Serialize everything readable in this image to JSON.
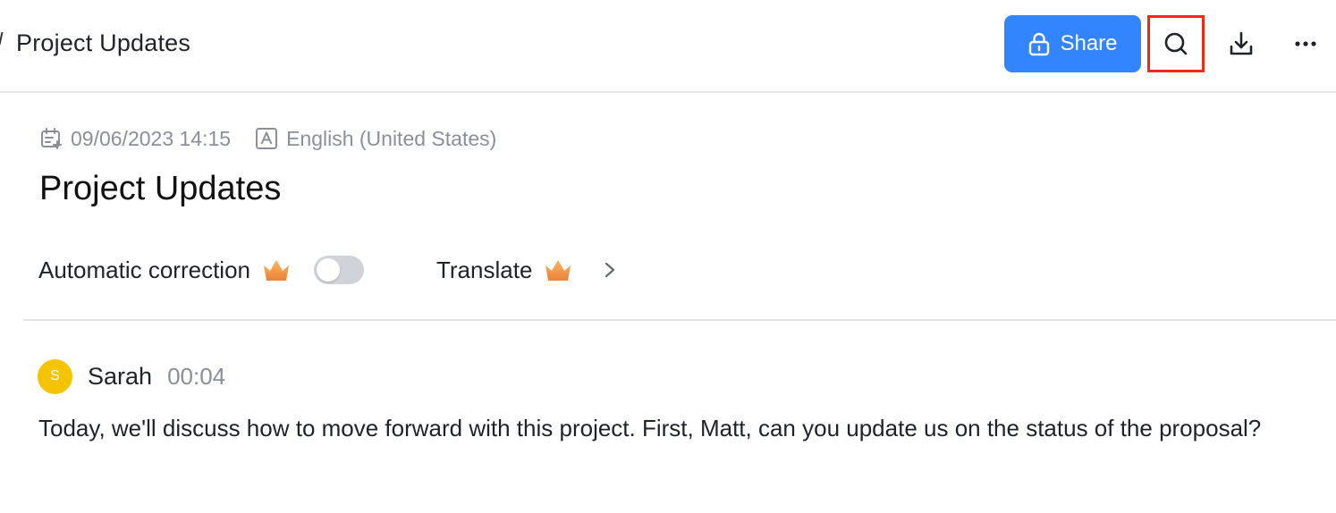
{
  "header": {
    "title": "Project Updates",
    "share_label": "Share",
    "icons": {
      "share": "lock-icon",
      "search": "search-icon",
      "download": "download-icon",
      "more": "more-icon"
    },
    "colors": {
      "share_bg": "#3385ff",
      "highlight": "#ee2a12"
    }
  },
  "meta": {
    "datetime": "09/06/2023 14:15",
    "language": "English (United States)"
  },
  "document": {
    "title": "Project Updates"
  },
  "options": {
    "auto_correction_label": "Automatic correction",
    "auto_correction_on": false,
    "translate_label": "Translate"
  },
  "transcript": {
    "speaker": {
      "initial": "S",
      "name": "Sarah",
      "time": "00:04",
      "avatar_color": "#f5c400"
    },
    "text": "Today, we'll discuss how to move forward with this project. First, Matt, can you update us on the status of the proposal?"
  }
}
